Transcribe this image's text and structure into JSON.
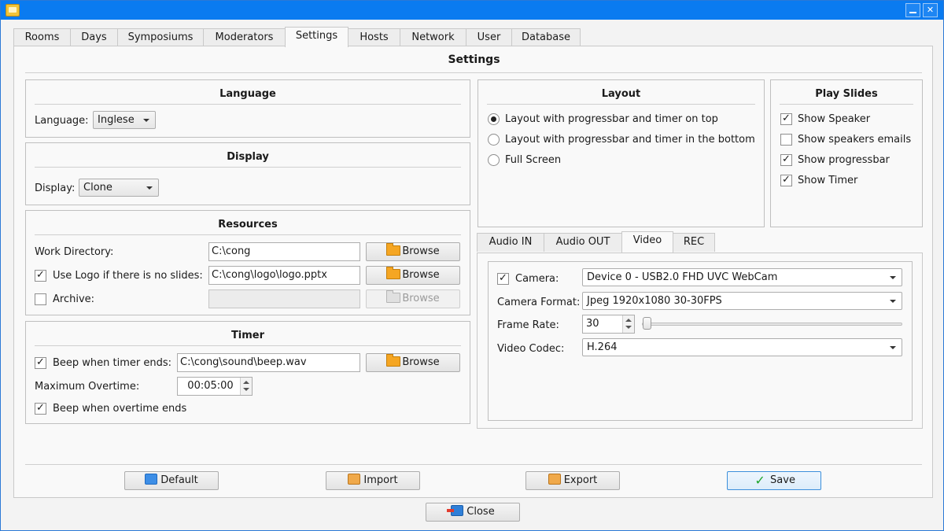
{
  "window": {
    "minimize_icon": "minimize-icon",
    "close_glyph": "✕"
  },
  "tabs": [
    "Rooms",
    "Days",
    "Symposiums",
    "Moderators",
    "Settings",
    "Hosts",
    "Network",
    "User",
    "Database"
  ],
  "panel_title": "Settings",
  "language": {
    "title": "Language",
    "label": "Language:",
    "value": "Inglese"
  },
  "display": {
    "title": "Display",
    "label": "Display:",
    "value": "Clone"
  },
  "resources": {
    "title": "Resources",
    "work_dir_label": "Work Directory:",
    "work_dir_value": "C:\\cong",
    "use_logo_label": "Use Logo if there is no slides:",
    "use_logo_checked": true,
    "logo_value": "C:\\cong\\logo\\logo.pptx",
    "archive_label": "Archive:",
    "archive_checked": false,
    "archive_value": "",
    "browse_label": "Browse"
  },
  "timer": {
    "title": "Timer",
    "beep_label": "Beep when timer ends:",
    "beep_checked": true,
    "beep_value": "C:\\cong\\sound\\beep.wav",
    "max_overtime_label": "Maximum Overtime:",
    "max_overtime_value": "00:05:00",
    "beep_overtime_label": "Beep when overtime ends",
    "beep_overtime_checked": true,
    "browse_label": "Browse"
  },
  "layout": {
    "title": "Layout",
    "options": [
      {
        "label": "Layout with progressbar and timer on top",
        "selected": true
      },
      {
        "label": "Layout with progressbar and timer in the bottom",
        "selected": false
      },
      {
        "label": "Full Screen",
        "selected": false
      }
    ]
  },
  "play_slides": {
    "title": "Play Slides",
    "options": [
      {
        "label": "Show Speaker",
        "checked": true
      },
      {
        "label": "Show speakers emails",
        "checked": false
      },
      {
        "label": "Show progressbar",
        "checked": true
      },
      {
        "label": "Show Timer",
        "checked": true
      }
    ]
  },
  "av_tabs": [
    "Audio IN",
    "Audio OUT",
    "Video",
    "REC"
  ],
  "video": {
    "camera_label": "Camera:",
    "camera_checked": true,
    "camera_value": "Device 0 - USB2.0 FHD UVC WebCam",
    "format_label": "Camera Format:",
    "format_value": "Jpeg 1920x1080 30-30FPS",
    "frame_rate_label": "Frame Rate:",
    "frame_rate_value": "30",
    "codec_label": "Video Codec:",
    "codec_value": "H.264"
  },
  "buttons": {
    "default": "Default",
    "import": "Import",
    "export": "Export",
    "save": "Save",
    "close": "Close"
  },
  "check_glyph": "✓"
}
